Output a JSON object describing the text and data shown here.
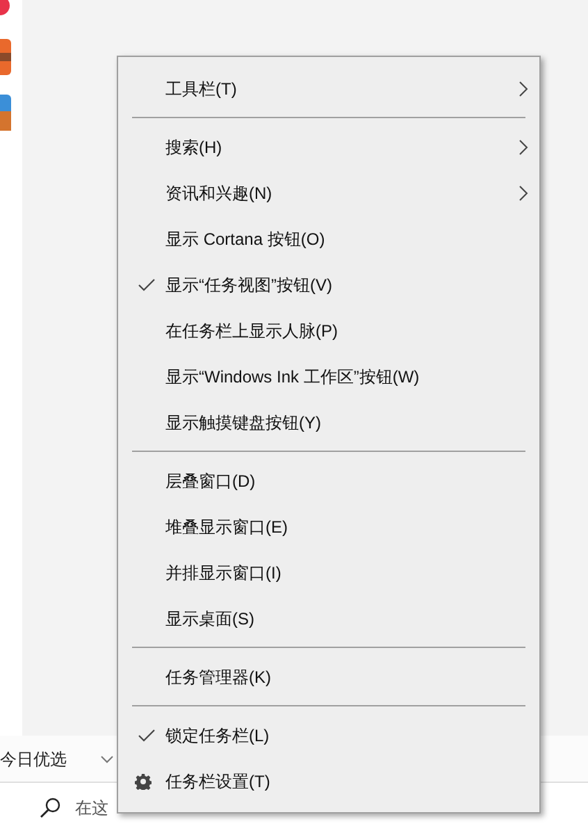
{
  "left_panel": {
    "feed_label": "今日优选",
    "search_placeholder": "在这"
  },
  "context_menu": {
    "items": [
      {
        "kind": "item",
        "label": "工具栏(T)",
        "checked": false,
        "submenu": true
      },
      {
        "kind": "separator"
      },
      {
        "kind": "item",
        "label": "搜索(H)",
        "checked": false,
        "submenu": true
      },
      {
        "kind": "item",
        "label": "资讯和兴趣(N)",
        "checked": false,
        "submenu": true
      },
      {
        "kind": "item",
        "label": "显示 Cortana 按钮(O)",
        "checked": false,
        "submenu": false
      },
      {
        "kind": "item",
        "label": "显示“任务视图”按钮(V)",
        "checked": true,
        "submenu": false
      },
      {
        "kind": "item",
        "label": "在任务栏上显示人脉(P)",
        "checked": false,
        "submenu": false
      },
      {
        "kind": "item",
        "label": "显示“Windows Ink 工作区”按钮(W)",
        "checked": false,
        "submenu": false
      },
      {
        "kind": "item",
        "label": "显示触摸键盘按钮(Y)",
        "checked": false,
        "submenu": false
      },
      {
        "kind": "separator"
      },
      {
        "kind": "item",
        "label": "层叠窗口(D)",
        "checked": false,
        "submenu": false
      },
      {
        "kind": "item",
        "label": "堆叠显示窗口(E)",
        "checked": false,
        "submenu": false
      },
      {
        "kind": "item",
        "label": "并排显示窗口(I)",
        "checked": false,
        "submenu": false
      },
      {
        "kind": "item",
        "label": "显示桌面(S)",
        "checked": false,
        "submenu": false
      },
      {
        "kind": "separator"
      },
      {
        "kind": "item",
        "label": "任务管理器(K)",
        "checked": false,
        "submenu": false
      },
      {
        "kind": "separator"
      },
      {
        "kind": "item",
        "label": "锁定任务栏(L)",
        "checked": true,
        "submenu": false
      },
      {
        "kind": "settings",
        "label": "任务栏设置(T)"
      }
    ]
  }
}
